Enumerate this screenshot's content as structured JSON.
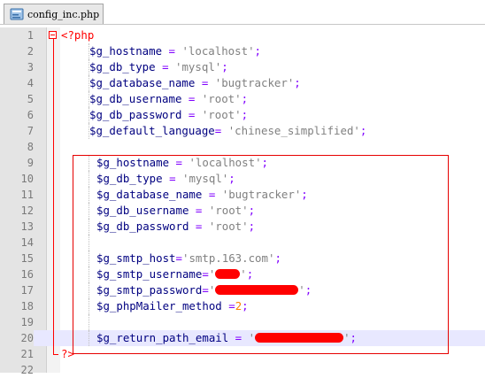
{
  "tab": {
    "label": "config_inc.php",
    "icon": "php-file-icon"
  },
  "lines": [
    {
      "num": "1",
      "code": "<?php"
    },
    {
      "num": "2",
      "code": "$g_hostname = 'localhost';"
    },
    {
      "num": "3",
      "code": "$g_db_type = 'mysql';"
    },
    {
      "num": "4",
      "code": "$g_database_name = 'bugtracker';"
    },
    {
      "num": "5",
      "code": "$g_db_username = 'root';"
    },
    {
      "num": "6",
      "code": "$g_db_password = 'root';"
    },
    {
      "num": "7",
      "code": "$g_default_language= 'chinese_simplified';"
    },
    {
      "num": "8",
      "code": ""
    },
    {
      "num": "9",
      "code": "$g_hostname = 'localhost';"
    },
    {
      "num": "10",
      "code": "$g_db_type = 'mysql';"
    },
    {
      "num": "11",
      "code": "$g_database_name = 'bugtracker';"
    },
    {
      "num": "12",
      "code": "$g_db_username = 'root';"
    },
    {
      "num": "13",
      "code": "$g_db_password = 'root';"
    },
    {
      "num": "14",
      "code": ""
    },
    {
      "num": "15",
      "code": "$g_smtp_host='smtp.163.com';"
    },
    {
      "num": "16",
      "code": "$g_smtp_username='[redacted]';"
    },
    {
      "num": "17",
      "code": "$g_smtp_password='[redacted]';"
    },
    {
      "num": "18",
      "code": "$g_phpMailer_method =2;"
    },
    {
      "num": "19",
      "code": ""
    },
    {
      "num": "20",
      "code": "$g_return_path_email = '[redacted]';"
    },
    {
      "num": "21",
      "code": "?>"
    },
    {
      "num": "22",
      "code": ""
    }
  ],
  "active_line": "20",
  "colors": {
    "tag": "#ff0000",
    "variable": "#000080",
    "operator": "#8000ff",
    "string": "#808080",
    "number": "#ff8000",
    "annotation": "#e60000",
    "active_line": "#e8e8ff"
  }
}
